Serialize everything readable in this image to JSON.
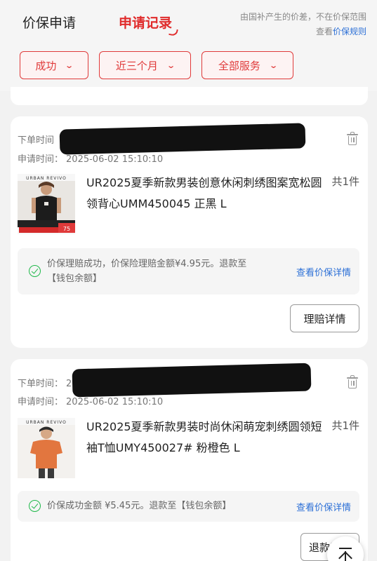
{
  "header": {
    "tab_price_protect": "价保申请",
    "tab_records": "申请记录",
    "notice_line1": "由国补产生的价差，不在价保范围",
    "notice_prefix": "查看",
    "notice_link": "价保规则"
  },
  "filters": [
    {
      "label": "成功"
    },
    {
      "label": "近三个月"
    },
    {
      "label": "全部服务"
    }
  ],
  "orders": [
    {
      "order_time_label": "下单时间",
      "apply_time_label": "申请时间",
      "apply_time": "2025-06-02 15:10:10",
      "thumb_brand": "URBAN REVIVO",
      "thumb_price_tag": "75",
      "title": "UR2025夏季新款男装创意休闲刺绣图案宽松圆领背心UMM450045 正黑 L",
      "qty": "共1件",
      "status_text": "价保理赔成功，价保险理赔金额¥4.95元。退款至【钱包余额】",
      "status_link": "查看价保详情",
      "action_button": "理赔详情"
    },
    {
      "order_time_label": "下单时间",
      "order_time_partial": "20",
      "apply_time_label": "申请时间",
      "apply_time": "2025-06-02 15:10:10",
      "thumb_brand": "URBAN REVIVO",
      "title": "UR2025夏季新款男装时尚休闲萌宠刺绣圆领短袖T恤UMY450027# 粉橙色 L",
      "qty": "共1件",
      "status_text": "价保成功金额 ¥5.45元。退款至【钱包余额】",
      "status_link": "查看价保详情",
      "action_button": "退款详情"
    }
  ],
  "colors": {
    "accent_red": "#e02b2b",
    "link_blue": "#2b6fd6",
    "success_green": "#1fb84a"
  }
}
